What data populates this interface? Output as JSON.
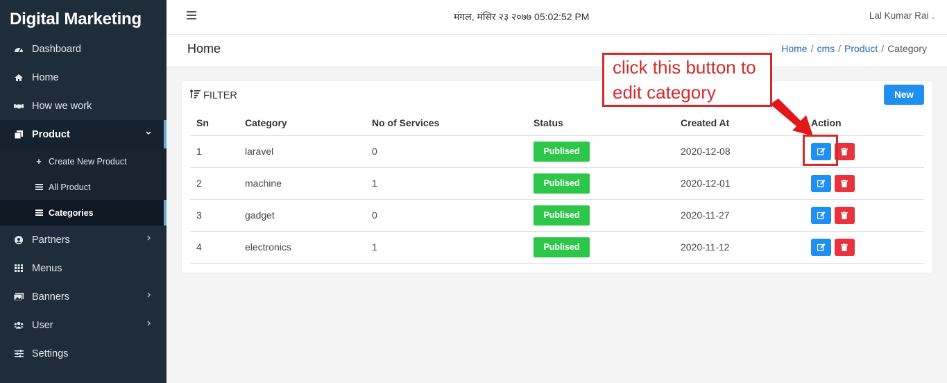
{
  "app": {
    "brand": "Digital Marketing"
  },
  "sidebar": {
    "items": [
      {
        "label": "Dashboard",
        "icon": "gauge-icon"
      },
      {
        "label": "Home",
        "icon": "home-icon"
      },
      {
        "label": "How we work",
        "icon": "handshake-icon"
      },
      {
        "label": "Product",
        "icon": "copy-icon",
        "active": true
      },
      {
        "label": "Partners",
        "icon": "user-circle-icon"
      },
      {
        "label": "Menus",
        "icon": "grid-icon"
      },
      {
        "label": "Banners",
        "icon": "image-icon"
      },
      {
        "label": "User",
        "icon": "users-icon"
      },
      {
        "label": "Settings",
        "icon": "sliders-icon"
      }
    ],
    "product_sub": [
      {
        "label": "Create New Product",
        "icon": "plus-icon"
      },
      {
        "label": "All Product",
        "icon": "list-icon"
      },
      {
        "label": "Categories",
        "icon": "list-icon",
        "active": true
      }
    ]
  },
  "topbar": {
    "datetime": "मंगल, मंसिर २३ २०७७ 05:02:52 PM",
    "user": "Lal Kumar Rai"
  },
  "page": {
    "title": "Home",
    "breadcrumb": [
      "Home",
      "cms",
      "Product",
      "Category"
    ]
  },
  "card": {
    "filter_label": "FILTER",
    "new_label": "New"
  },
  "table": {
    "headers": [
      "Sn",
      "Category",
      "No of Services",
      "Status",
      "Created At",
      "Action"
    ],
    "rows": [
      {
        "sn": "1",
        "category": "laravel",
        "services": "0",
        "status": "Publised",
        "created": "2020-12-08"
      },
      {
        "sn": "2",
        "category": "machine",
        "services": "1",
        "status": "Publised",
        "created": "2020-12-01"
      },
      {
        "sn": "3",
        "category": "gadget",
        "services": "0",
        "status": "Publised",
        "created": "2020-11-27"
      },
      {
        "sn": "4",
        "category": "electronics",
        "services": "1",
        "status": "Publised",
        "created": "2020-11-12"
      }
    ]
  },
  "annotation": {
    "line1": "click this button to",
    "line2": "edit category",
    "color": "#d52a2a"
  },
  "colors": {
    "sidebar_bg": "#1f2d3b",
    "primary": "#1f8ff2",
    "success": "#2cc74a",
    "danger": "#e8323e"
  }
}
